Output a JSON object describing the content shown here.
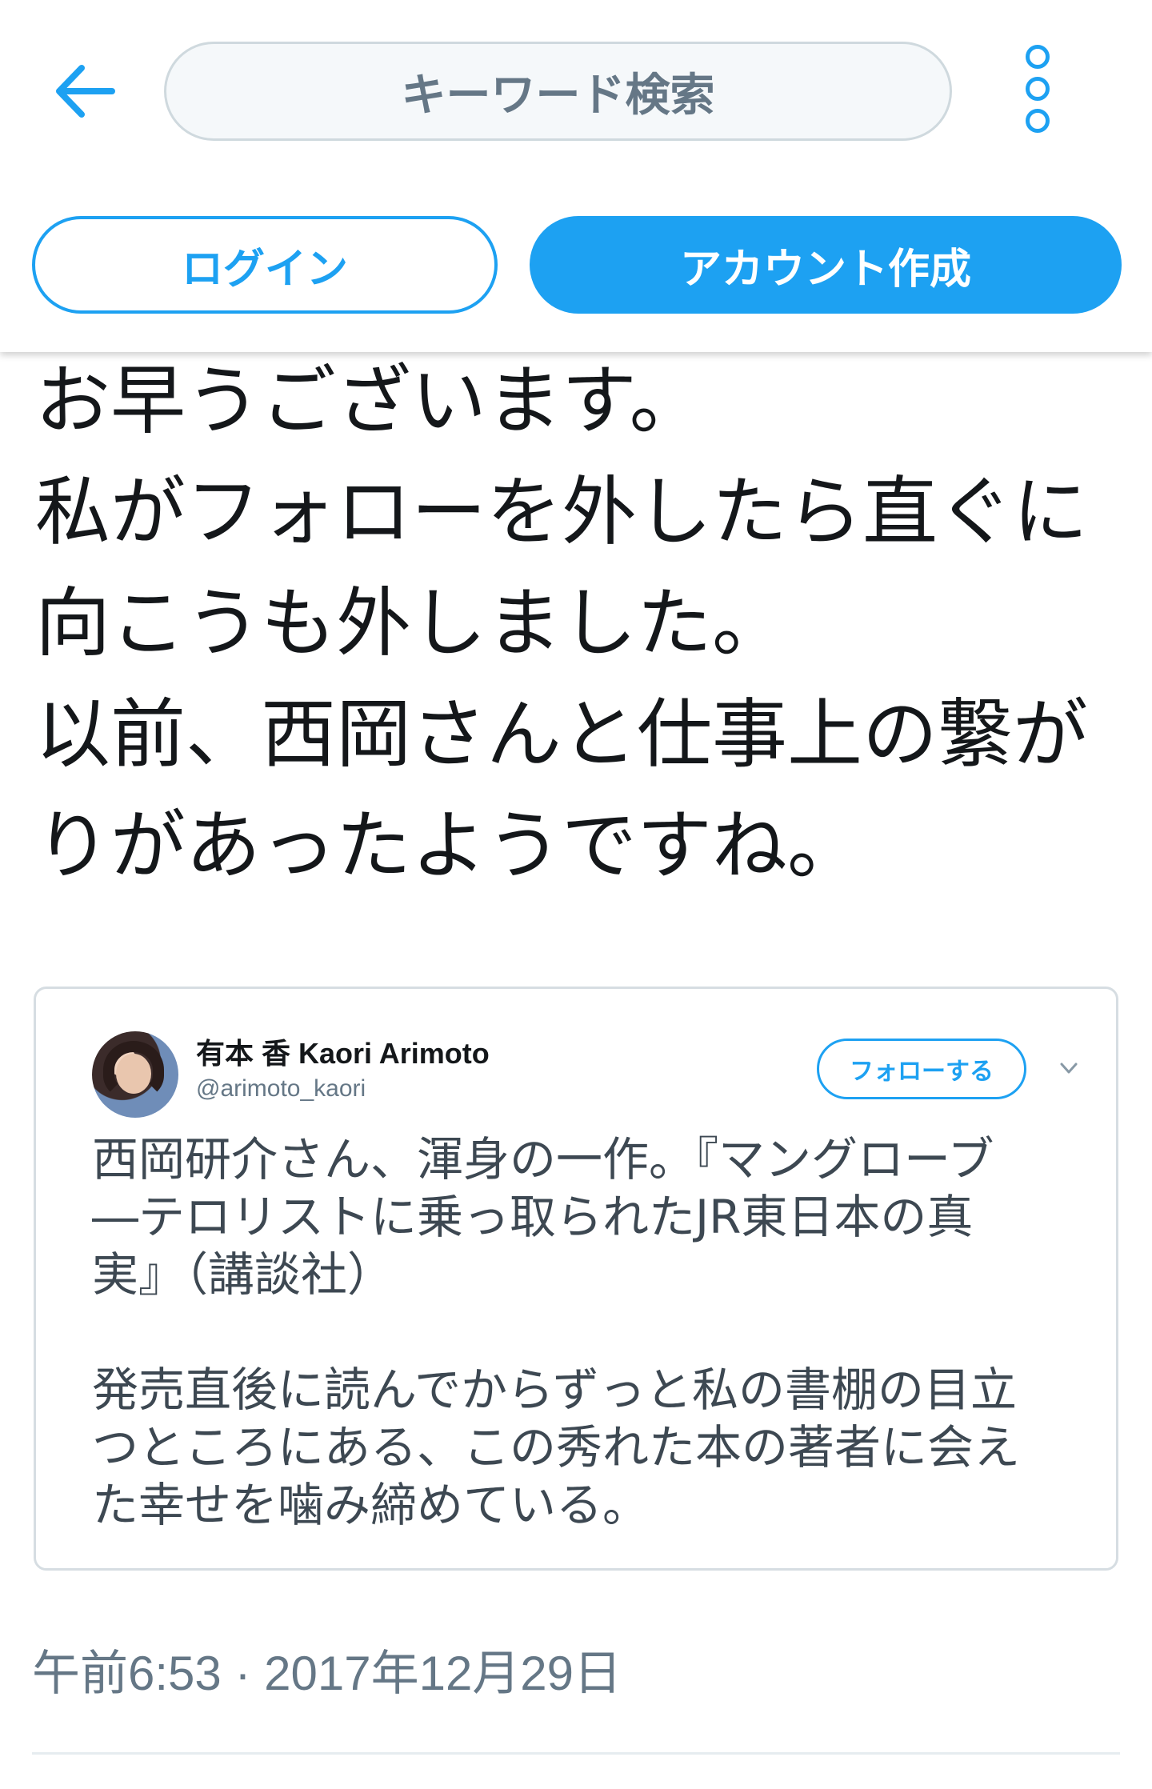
{
  "header": {
    "search_placeholder": "キーワード検索",
    "login_label": "ログイン",
    "signup_label": "アカウント作成",
    "back_icon": "arrow-left-icon",
    "more_icon": "more-vertical-icon",
    "accent_color": "#1da1f2"
  },
  "tweet": {
    "text": "お早うございます。\n私がフォローを外したら直ぐに\n向こうも外しました。\n以前、西岡さんと仕事上の繋が\nりがあったようですね。",
    "timestamp": "午前6:53 · 2017年12月29日"
  },
  "embedded_tweet": {
    "name": "有本 香 Kaori Arimoto",
    "handle": "@arimoto_kaori",
    "follow_label": "フォローする",
    "text": "西岡研介さん、渾身の一作。『マングローブ\n―テロリストに乗っ取られたJR東日本の真\n実』（講談社）\n\n発売直後に読んでからずっと私の書棚の目立\nつところにある、この秀れた本の著者に会え\nた幸せを噛み締めている。"
  }
}
